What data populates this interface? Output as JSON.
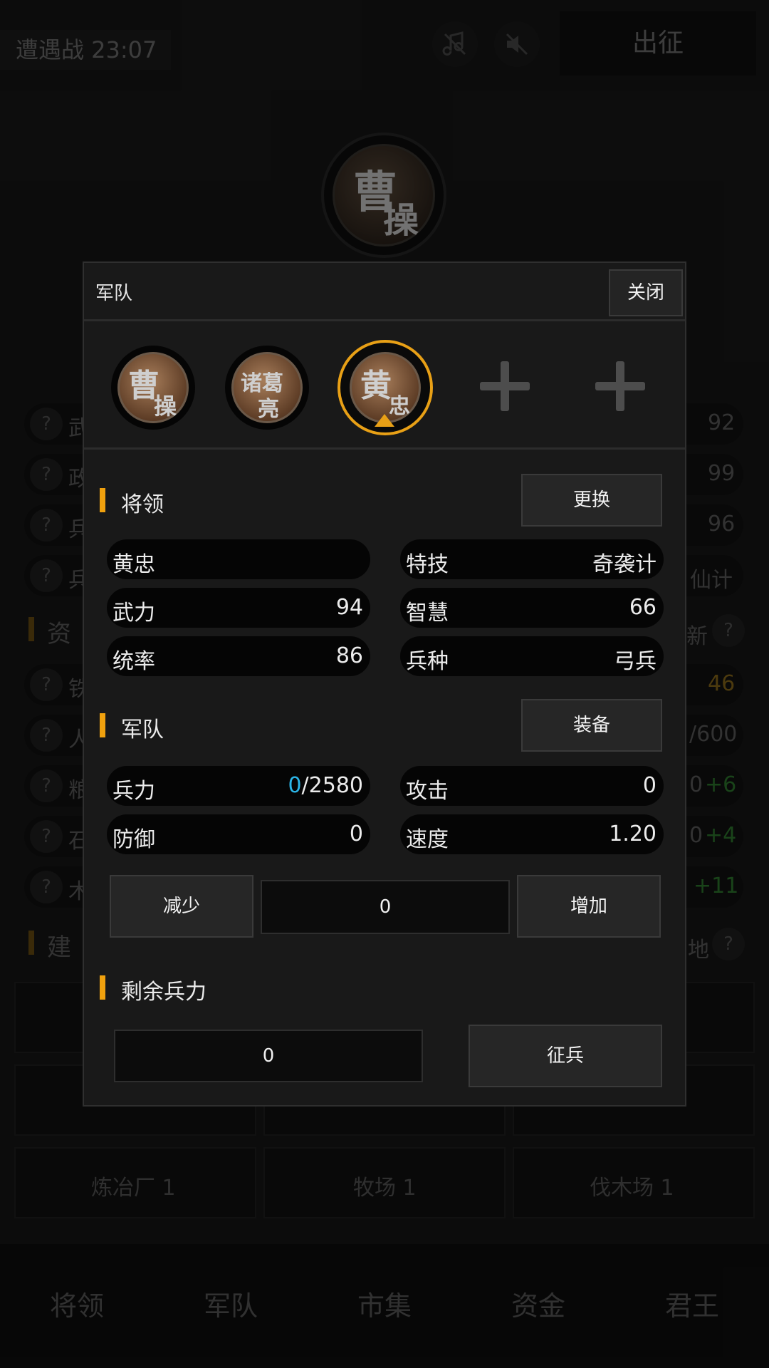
{
  "background": {
    "battle_label": "遭遇战 23:07",
    "march_button": "出征",
    "hero_name_top": "曹",
    "hero_name_bottom": "操",
    "stats_right": [
      "92",
      "99",
      "96",
      "仙计"
    ],
    "stats_left_initials": [
      "武",
      "政",
      "兵",
      "兵"
    ],
    "resources_heading_partial": "资",
    "resources_refresh_partial": "新",
    "resources": [
      {
        "initial": "铁",
        "value": "46",
        "delta": ""
      },
      {
        "initial": "人",
        "value": "/600",
        "delta": ""
      },
      {
        "initial": "粮",
        "value": "0",
        "delta": "+6"
      },
      {
        "initial": "石",
        "value": "0",
        "delta": "+4"
      },
      {
        "initial": "木",
        "value": "",
        "delta": "+11"
      }
    ],
    "buildings_heading_partial": "建",
    "buildings_add_partial": "地",
    "buildings": [
      "炼冶厂 1",
      "牧场 1",
      "伐木场 1"
    ],
    "bottom_nav": [
      "将领",
      "军队",
      "市集",
      "资金",
      "君王"
    ]
  },
  "modal": {
    "title": "军队",
    "close_label": "关闭",
    "heroes": [
      {
        "top": "曹",
        "bottom": "操"
      },
      {
        "top": "诸葛",
        "bottom": "亮"
      },
      {
        "top": "黄",
        "bottom": "忠"
      }
    ],
    "selected_hero_index": 2,
    "general_section": {
      "title": "将领",
      "swap_label": "更换",
      "name": "黄忠",
      "special_label": "特技",
      "special_value": "奇袭计",
      "force_label": "武力",
      "force_value": "94",
      "wisdom_label": "智慧",
      "wisdom_value": "66",
      "command_label": "统率",
      "command_value": "86",
      "troop_type_label": "兵种",
      "troop_type_value": "弓兵"
    },
    "army_section": {
      "title": "军队",
      "equip_label": "装备",
      "troops_label": "兵力",
      "troops_current": "0",
      "troops_max": "/2580",
      "attack_label": "攻击",
      "attack_value": "0",
      "defense_label": "防御",
      "defense_value": "0",
      "speed_label": "速度",
      "speed_value": "1.20",
      "decrease_label": "减少",
      "amount_value": "0",
      "increase_label": "增加"
    },
    "remaining_section": {
      "title": "剩余兵力",
      "remaining_value": "0",
      "conscript_label": "征兵"
    }
  },
  "colors": {
    "accent": "#f0a10e",
    "highlight": "#2bb5e8",
    "green": "#2f7a2f",
    "orange": "#8a6a1a"
  }
}
